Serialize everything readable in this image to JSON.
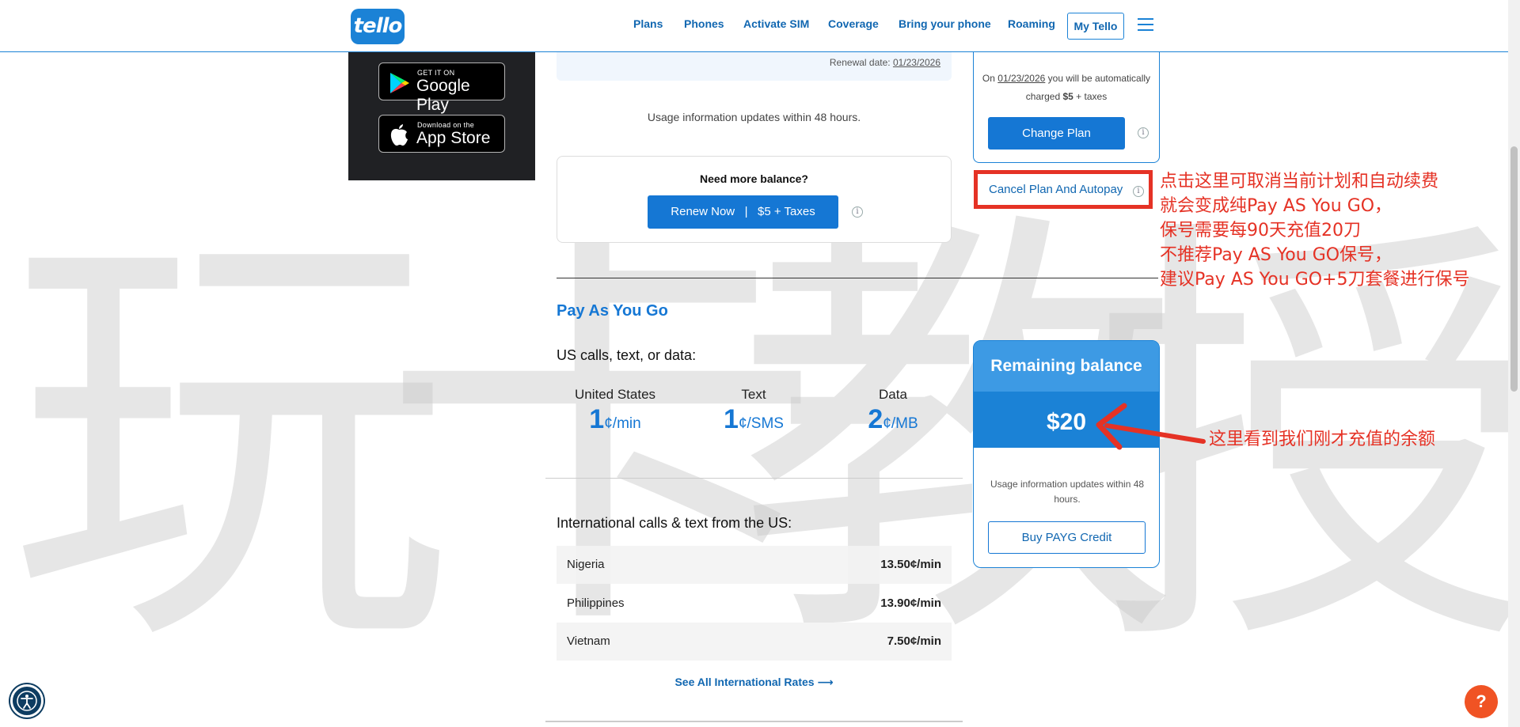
{
  "header": {
    "logo": "tello",
    "nav": [
      "Plans",
      "Phones",
      "Activate SIM",
      "Coverage",
      "Bring your phone",
      "Roaming"
    ],
    "my_tello": "My Tello"
  },
  "apps": {
    "google_small": "GET IT ON",
    "google_big": "Google Play",
    "apple_small": "Download on the",
    "apple_big": "App Store"
  },
  "plan": {
    "renewal_label": "Renewal date: ",
    "renewal_date": "01/23/2026",
    "usage_note": "Usage information updates within 48 hours.",
    "need_more": "Need more balance?",
    "renew_button": "Renew Now   |   $5 + Taxes",
    "autopay_prefix": "On ",
    "autopay_date": "01/23/2026",
    "autopay_mid": " you will be automatically",
    "autopay_charged": "charged ",
    "autopay_amount": "$5",
    "autopay_suffix": " + taxes",
    "change_plan": "Change Plan",
    "cancel_plan": "Cancel Plan And Autopay"
  },
  "annotations": {
    "cancel_note": [
      "点击这里可取消当前计划和自动续费",
      "就会变成纯Pay AS You GO，",
      "保号需要每90天充值20刀",
      "不推荐Pay AS You GO保号，",
      "建议Pay AS You GO+5刀套餐进行保号"
    ],
    "balance_note": "这里看到我们刚才充值的余额",
    "watermark": [
      "玩",
      "卡",
      "教",
      "授"
    ],
    "highlight_color": "#e53225"
  },
  "payg": {
    "title": "Pay As You Go",
    "us_label": "US calls, text, or data:",
    "rates": [
      {
        "label": "United States",
        "value": "1",
        "unit": "¢/min"
      },
      {
        "label": "Text",
        "value": "1",
        "unit": "¢/SMS"
      },
      {
        "label": "Data",
        "value": "2",
        "unit": "¢/MB"
      }
    ],
    "intl_label": "International calls & text from the US:",
    "intl": [
      {
        "country": "Nigeria",
        "price": "13.50¢/min"
      },
      {
        "country": "Philippines",
        "price": "13.90¢/min"
      },
      {
        "country": "Vietnam",
        "price": "7.50¢/min"
      }
    ],
    "see_all": "See All International Rates ⟶"
  },
  "balance": {
    "title": "Remaining balance",
    "amount": "$20",
    "note": "Usage information updates within 48 hours.",
    "buy_button": "Buy PAYG Credit"
  },
  "colors": {
    "brand_blue": "#1b82d6",
    "button_blue": "#1577d4"
  },
  "help": "?"
}
